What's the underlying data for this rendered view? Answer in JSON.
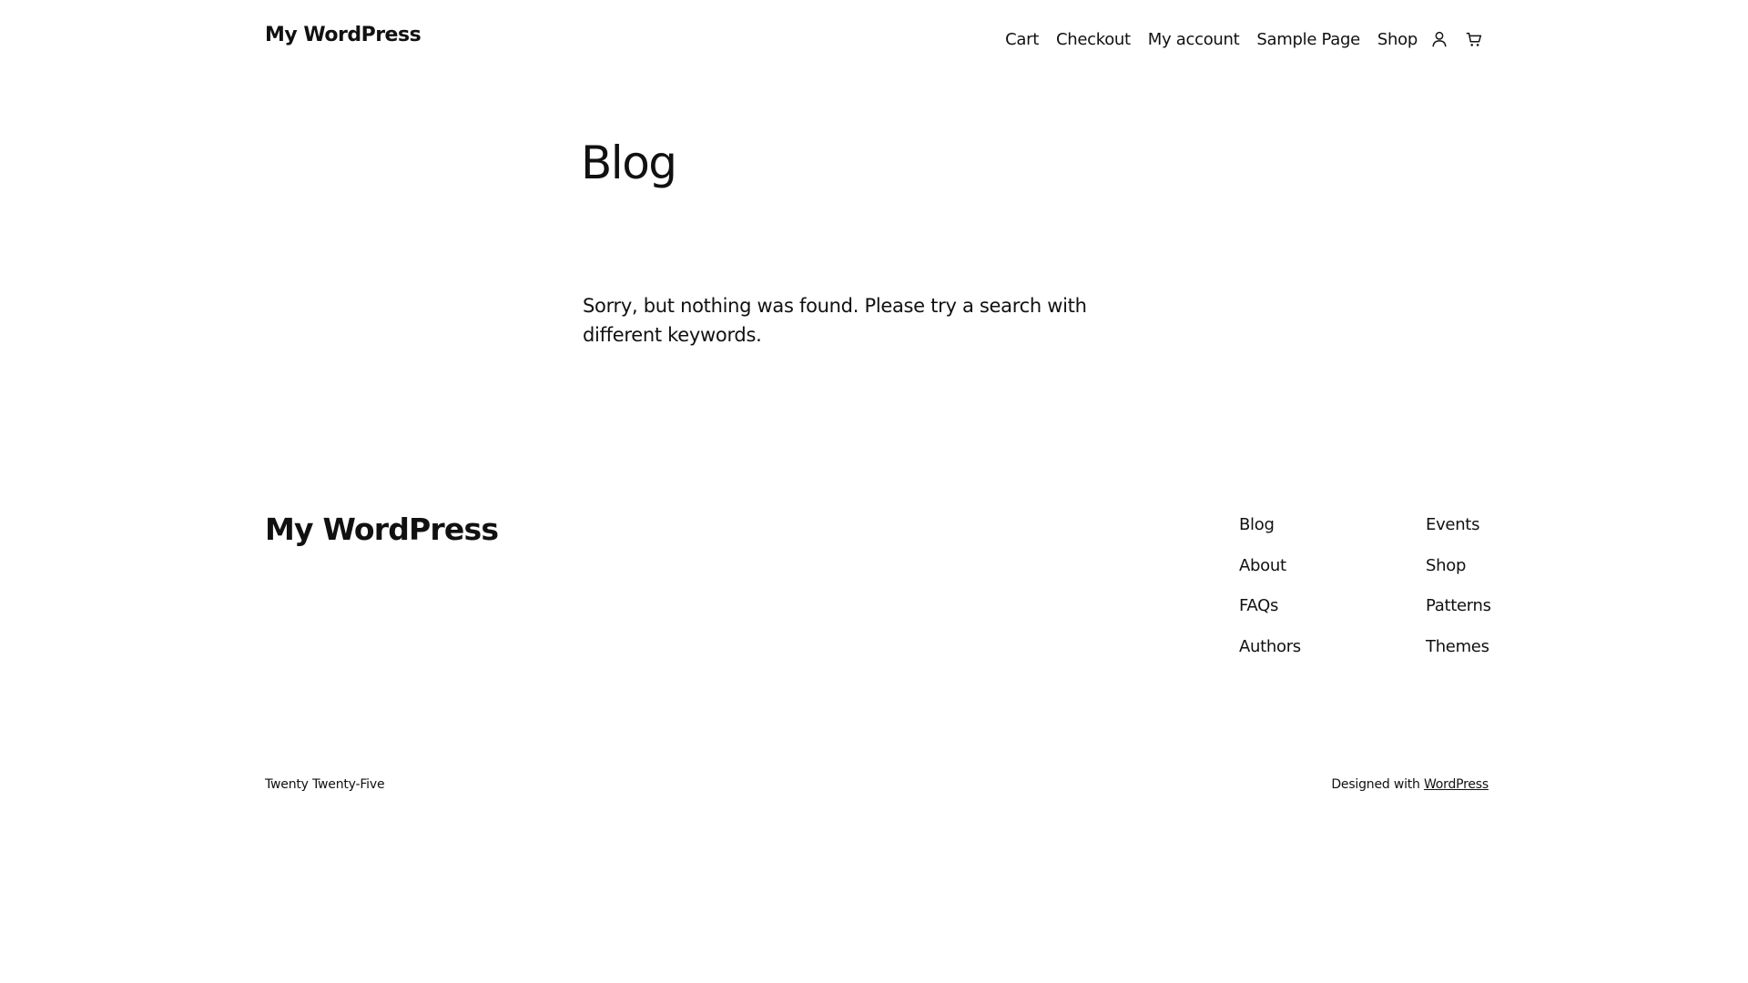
{
  "header": {
    "site_title": "My WordPress",
    "nav": [
      {
        "label": "Cart"
      },
      {
        "label": "Checkout"
      },
      {
        "label": "My account"
      },
      {
        "label": "Sample Page"
      },
      {
        "label": "Shop"
      }
    ],
    "icons": [
      "account-icon",
      "cart-icon"
    ]
  },
  "main": {
    "heading": "Blog",
    "message": "Sorry, but nothing was found. Please try a search with different keywords."
  },
  "footer": {
    "site_title": "My WordPress",
    "columns": [
      [
        {
          "label": "Blog"
        },
        {
          "label": "About"
        },
        {
          "label": "FAQs"
        },
        {
          "label": "Authors"
        }
      ],
      [
        {
          "label": "Events"
        },
        {
          "label": "Shop"
        },
        {
          "label": "Patterns"
        },
        {
          "label": "Themes"
        }
      ]
    ],
    "theme_name": "Twenty Twenty-Five",
    "designed_with": "Designed with",
    "designed_with_link": "WordPress"
  },
  "colors": {
    "background": "#ffffff",
    "text": "#111111"
  }
}
